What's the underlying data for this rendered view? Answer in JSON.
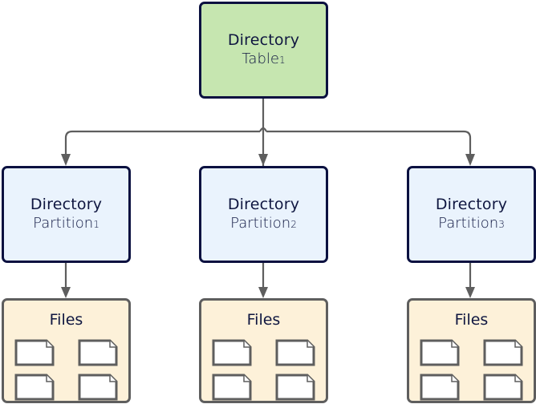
{
  "diagram": {
    "root": {
      "line1": "Directory",
      "line2": "Table",
      "sub": "1",
      "fill": "#c6e6b0"
    },
    "partitions": [
      {
        "line1": "Directory",
        "line2": "Partition",
        "sub": "1"
      },
      {
        "line1": "Directory",
        "line2": "Partition",
        "sub": "2"
      },
      {
        "line1": "Directory",
        "line2": "Partition",
        "sub": "3"
      }
    ],
    "file_groups": [
      {
        "title": "Files",
        "file_count": 4
      },
      {
        "title": "Files",
        "file_count": 4
      },
      {
        "title": "Files",
        "file_count": 4
      }
    ],
    "colors": {
      "partition_fill": "#eaf3fd",
      "files_fill": "#fdf1d9",
      "border_dark": "#0b1140",
      "connector": "#5e5e5e",
      "text": "#0f1640"
    }
  }
}
